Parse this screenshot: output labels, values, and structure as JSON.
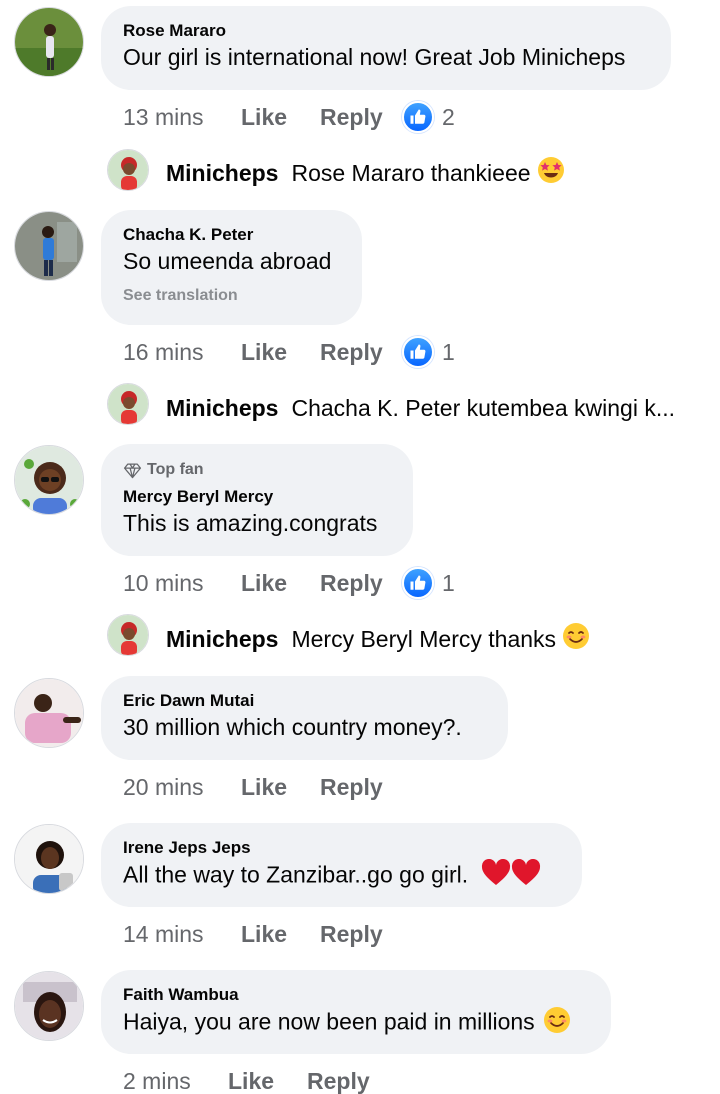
{
  "comments": [
    {
      "author": "Rose Mararo",
      "text": "Our girl is international now! Great Job Minicheps",
      "time": "13 mins",
      "like_label": "Like",
      "reply_label": "Reply",
      "reaction_count": "2",
      "reply": {
        "author": "Minicheps",
        "text": "Rose Mararo thankieee",
        "emoji": "star-struck-emoji"
      }
    },
    {
      "author": "Chacha K. Peter",
      "text": "So umeenda abroad",
      "see_translation": "See translation",
      "time": "16 mins",
      "like_label": "Like",
      "reply_label": "Reply",
      "reaction_count": "1",
      "reply": {
        "author": "Minicheps",
        "text": "Chacha K. Peter kutembea kwingi k..."
      }
    },
    {
      "badge": "Top fan",
      "author": "Mercy Beryl Mercy",
      "text": "This is amazing.congrats",
      "time": "10 mins",
      "like_label": "Like",
      "reply_label": "Reply",
      "reaction_count": "1",
      "reply": {
        "author": "Minicheps",
        "text": "Mercy Beryl Mercy thanks",
        "emoji": "smiling-blush-emoji"
      }
    },
    {
      "author": "Eric Dawn Mutai",
      "text": "30 million which country money?.",
      "time": "20 mins",
      "like_label": "Like",
      "reply_label": "Reply"
    },
    {
      "author": "Irene Jeps Jeps",
      "text": "All the way to Zanzibar..go go girl.",
      "emoji": "red-heart-emoji",
      "time": "14 mins",
      "like_label": "Like",
      "reply_label": "Reply"
    },
    {
      "author": "Faith Wambua",
      "text": "Haiya, you are now been paid in millions",
      "emoji": "smiling-blush-emoji",
      "time": "2 mins",
      "like_label": "Like",
      "reply_label": "Reply"
    }
  ],
  "colors": {
    "bubble": "#f0f2f5",
    "secondary_text": "#65676b",
    "like_blue": "#0866ff"
  }
}
